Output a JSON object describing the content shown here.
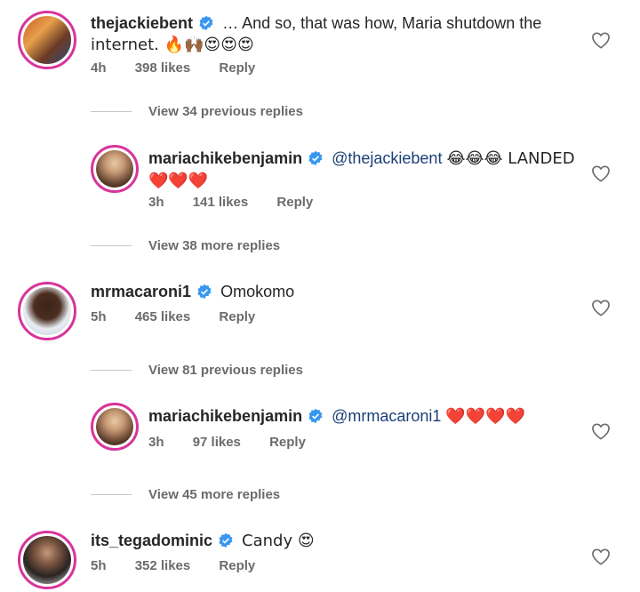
{
  "comments": [
    {
      "username": "thejackiebent",
      "text": "… And so, that was how, Maria shutdown the internet. 🔥🙌🏾😍😍😍",
      "line1": "… And so, that was how, Maria shutdown the",
      "line2": "internet. 🔥🙌🏾😍😍😍",
      "time": "4h",
      "likes": "398 likes",
      "reply": "Reply"
    },
    {
      "username": "mariachikebenjamin",
      "mention": "@thejackiebent",
      "text": "😂😂😂 LANDED ❤️❤️❤️",
      "line1_after": "😂😂😂 LANDED",
      "line2": "❤️❤️❤️",
      "time": "3h",
      "likes": "141 likes",
      "reply": "Reply"
    },
    {
      "username": "mrmacaroni1",
      "text": "Omokomo",
      "time": "5h",
      "likes": "465 likes",
      "reply": "Reply"
    },
    {
      "username": "mariachikebenjamin",
      "mention": "@mrmacaroni1",
      "text": "❤️❤️❤️❤️",
      "time": "3h",
      "likes": "97 likes",
      "reply": "Reply"
    },
    {
      "username": "its_tegadominic",
      "text": "Candy 😍",
      "time": "5h",
      "likes": "352 likes",
      "reply": "Reply"
    }
  ],
  "view_links": {
    "v1": "View 34 previous replies",
    "v2": "View 38 more replies",
    "v3": "View 81 previous replies",
    "v4": "View 45 more replies"
  },
  "icons": {
    "verified": "verified-badge-icon",
    "like": "heart-outline-icon"
  },
  "colors": {
    "verified_blue": "#3897f0",
    "avatar_ring": "#d8349b",
    "mention": "#1b3f76",
    "muted": "#6b6b6b"
  }
}
